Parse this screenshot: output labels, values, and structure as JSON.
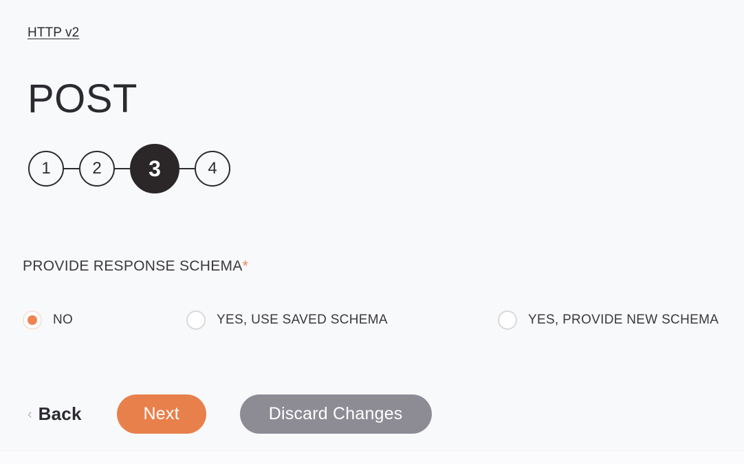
{
  "theme": {
    "background": "#f8f9fb",
    "accent": "#ef8354",
    "primary_button": "#e8804b",
    "secondary_button": "#8d8c95",
    "active_step": "#2b2729",
    "text": "#2b2a2f"
  },
  "breadcrumb": {
    "api_link": "HTTP v2"
  },
  "header": {
    "title": "POST"
  },
  "stepper": {
    "current": 3,
    "steps": [
      {
        "label": "1",
        "active": false
      },
      {
        "label": "2",
        "active": false
      },
      {
        "label": "3",
        "active": true
      },
      {
        "label": "4",
        "active": false
      }
    ]
  },
  "form": {
    "field_label": "PROVIDE RESPONSE SCHEMA",
    "required_marker": "*",
    "selected_value": "NO",
    "options": [
      {
        "label": "NO",
        "selected": true
      },
      {
        "label": "YES, USE SAVED SCHEMA",
        "selected": false
      },
      {
        "label": "YES, PROVIDE NEW SCHEMA",
        "selected": false
      }
    ]
  },
  "actions": {
    "back_chevron": "‹",
    "back_label": "Back",
    "next_label": "Next",
    "discard_label": "Discard Changes"
  }
}
